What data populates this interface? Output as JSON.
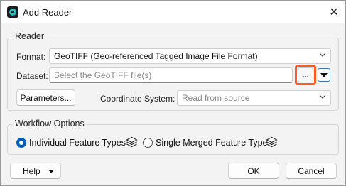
{
  "window": {
    "title": "Add Reader",
    "close_glyph": "✕"
  },
  "reader": {
    "group_label": "Reader",
    "format_label": "Format:",
    "format_value": "GeoTIFF (Geo-referenced Tagged Image File Format)",
    "dataset_label": "Dataset:",
    "dataset_placeholder": "Select the GeoTIFF file(s)",
    "browse_label": "...",
    "parameters_label": "Parameters...",
    "coord_label": "Coordinate System:",
    "coord_value": "Read from source"
  },
  "workflow": {
    "group_label": "Workflow Options",
    "option_individual": "Individual Feature Types",
    "option_single": "Single Merged Feature Type",
    "selected": "individual"
  },
  "footer": {
    "help_label": "Help",
    "ok_label": "OK",
    "cancel_label": "Cancel"
  },
  "colors": {
    "highlight": "#ff5a1f",
    "accent": "#005fb8",
    "app_icon": "#27c0c4"
  },
  "icons": {
    "app": "fme-app-icon",
    "close": "close-icon",
    "chevron": "chevron-down-icon",
    "layers": "layers-icon"
  }
}
